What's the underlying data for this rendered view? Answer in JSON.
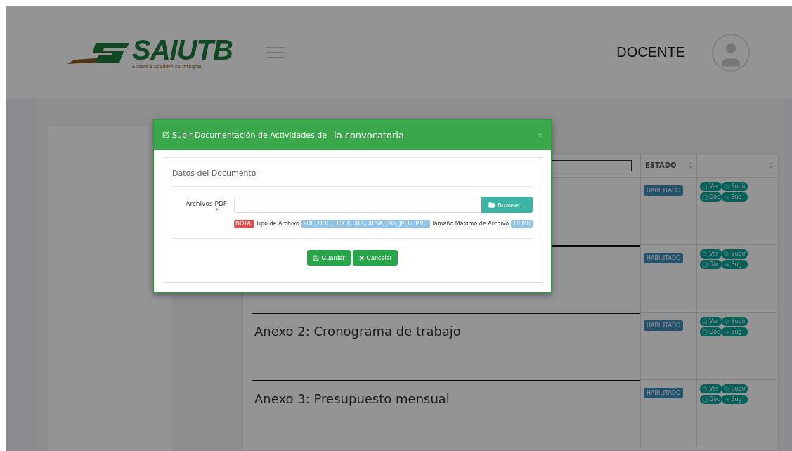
{
  "header": {
    "logo": {
      "title": "SAIUTB",
      "subtitle": "Sistema Académico Integral"
    },
    "user_role": "DOCENTE"
  },
  "table": {
    "status_header": "ESTADO",
    "rows": [
      {
        "status": "HABILITADO",
        "actions": [
          {
            "kind": "view",
            "label": "Ver"
          },
          {
            "kind": "upload",
            "label": "Subir"
          },
          {
            "kind": "doc",
            "label": "Doc"
          },
          {
            "kind": "share",
            "label": "Sug"
          }
        ]
      },
      {
        "status": "HABILITADO",
        "actions": [
          {
            "kind": "view",
            "label": "Ver"
          },
          {
            "kind": "upload",
            "label": "Subir"
          },
          {
            "kind": "doc",
            "label": "Doc"
          },
          {
            "kind": "share",
            "label": "Sug"
          }
        ]
      },
      {
        "title": "Anexo 2: Cronograma de trabajo",
        "status": "HABILITADO",
        "actions": [
          {
            "kind": "view",
            "label": "Ver"
          },
          {
            "kind": "upload",
            "label": "Subir"
          },
          {
            "kind": "doc",
            "label": "Doc"
          },
          {
            "kind": "share",
            "label": "Sug"
          }
        ]
      },
      {
        "title": "Anexo 3: Presupuesto mensual",
        "status": "HABILITADO",
        "actions": [
          {
            "kind": "view",
            "label": "Ver"
          },
          {
            "kind": "upload",
            "label": "Subir"
          },
          {
            "kind": "doc",
            "label": "Doc"
          },
          {
            "kind": "share",
            "label": "Sug"
          }
        ]
      }
    ]
  },
  "modal": {
    "title": "Subir Documentación de Actividades de",
    "title_suffix": "la convocatoria",
    "close": "×",
    "section": "Datos del Documento",
    "field": {
      "label": "Archivos PDF",
      "required_mark": "*",
      "browse": "Browse ..."
    },
    "note": {
      "badge": "NOTA:",
      "type_label": "Tipo de Archivo",
      "types": "PDF, DOC, DOCX, XLS, XLSX, JPG, JPEG, PNG",
      "size_label": "Tamaño Máximo de Archivo",
      "size": "10 MB"
    },
    "buttons": [
      {
        "kind": "save",
        "label": "Guardar"
      },
      {
        "kind": "cancel",
        "label": "Cancelar"
      }
    ]
  }
}
